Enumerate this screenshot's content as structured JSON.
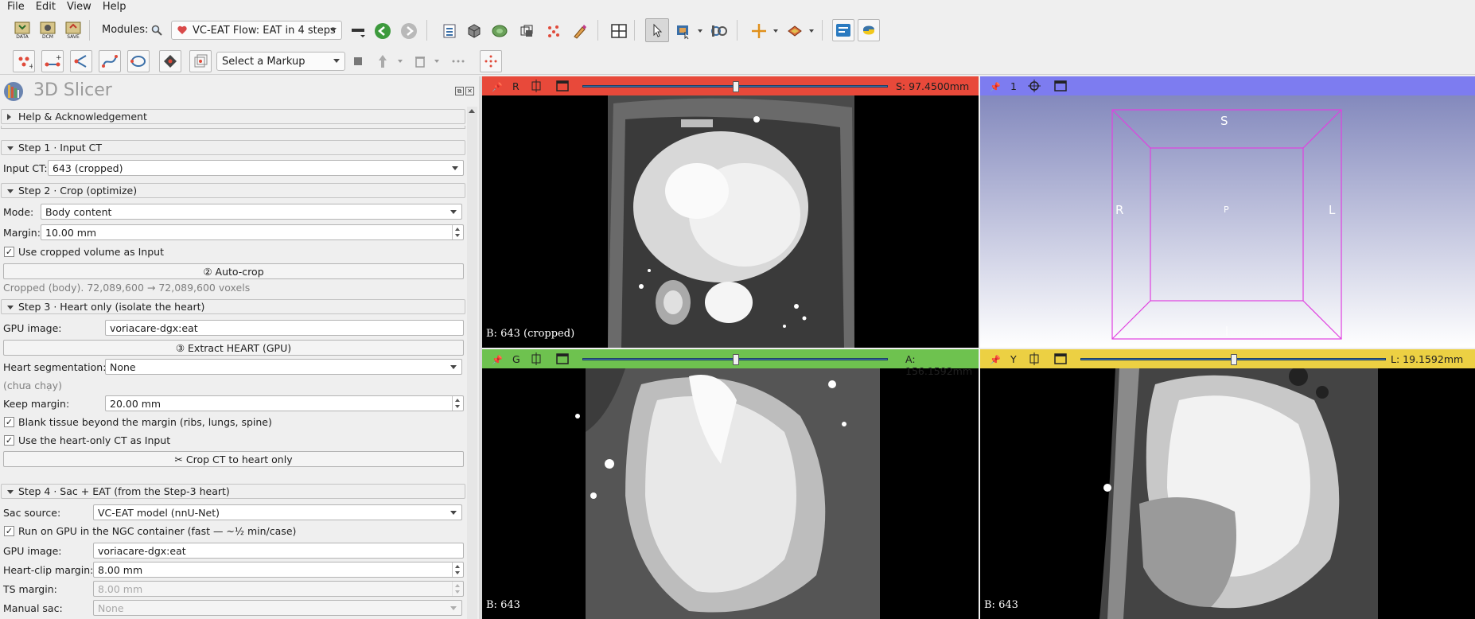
{
  "menu": [
    "File",
    "Edit",
    "View",
    "Help"
  ],
  "toolbar": {
    "modules_label": "Modules:",
    "module_selected": "VC-EAT Flow: EAT in 4 steps",
    "data_icon_text": "DATA",
    "dcm_icon_text": "DCM",
    "save_icon_text": "SAVE"
  },
  "markups": {
    "select_placeholder": "Select a Markup"
  },
  "app": {
    "title": "3D Slicer"
  },
  "help_section": "Help & Acknowledgement",
  "step1": {
    "title": "Step 1 · Input CT",
    "input_label": "Input CT:",
    "input_value": "643 (cropped)"
  },
  "step2": {
    "title": "Step 2 · Crop (optimize)",
    "mode_label": "Mode:",
    "mode_value": "Body content",
    "margin_label": "Margin:",
    "margin_value": "10.00 mm",
    "use_cropped_label": "Use cropped volume as Input",
    "autocrop_button": "② Auto-crop",
    "status": "Cropped (body). 72,089,600 → 72,089,600 voxels"
  },
  "step3": {
    "title": "Step 3 · Heart only (isolate the heart)",
    "gpu_label": "GPU image:",
    "gpu_value": "voriacare-dgx:eat",
    "extract_button": "③ Extract HEART (GPU)",
    "seg_label": "Heart segmentation:",
    "seg_value": "None",
    "seg_status": "(chưa chạy)",
    "keep_margin_label": "Keep margin:",
    "keep_margin_value": "20.00 mm",
    "blank_label": "Blank tissue beyond the margin (ribs, lungs, spine)",
    "use_heart_label": "Use the heart-only CT as Input",
    "crop_button": "✂ Crop CT to heart only"
  },
  "step4": {
    "title": "Step 4 · Sac + EAT (from the Step-3 heart)",
    "sac_source_label": "Sac source:",
    "sac_source_value": "VC-EAT model (nnU-Net)",
    "run_gpu_label": "Run on GPU in the NGC container (fast — ~½ min/case)",
    "gpu_label": "GPU image:",
    "gpu_value": "voriacare-dgx:eat",
    "heart_clip_label": "Heart-clip margin:",
    "heart_clip_value": "8.00 mm",
    "ts_margin_label": "TS margin:",
    "ts_margin_value": "8.00 mm",
    "manual_sac_label": "Manual sac:",
    "manual_sac_value": "None"
  },
  "views": {
    "red": {
      "letter": "R",
      "value": "S: 97.4500mm",
      "corner": "B: 643 (cropped)",
      "slider_fraction": 0.5,
      "color": "#e8493a"
    },
    "threed": {
      "letter": "1",
      "color": "#7d7cf0",
      "labels": {
        "top": "S",
        "left": "R",
        "right": "L",
        "center": "P"
      }
    },
    "green": {
      "letter": "G",
      "value": "A: 156.1592mm",
      "corner": "B: 643",
      "slider_fraction": 0.5,
      "color": "#6ec24f"
    },
    "yellow": {
      "letter": "Y",
      "value": "L: 19.1592mm",
      "corner": "B: 643",
      "slider_fraction": 0.5,
      "color": "#ecd043"
    }
  }
}
